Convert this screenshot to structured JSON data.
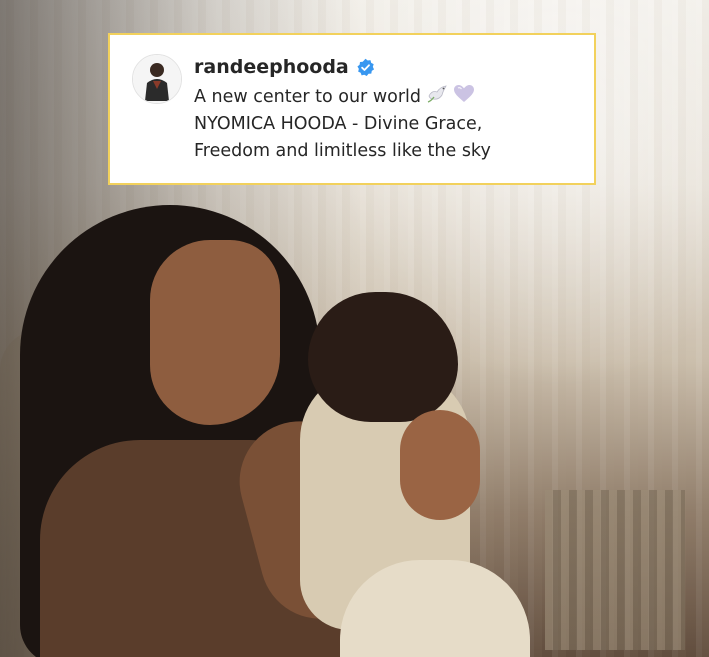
{
  "post": {
    "username": "randeephooda",
    "verified": true,
    "caption_lines": [
      "A new center to our world",
      "NYOMICA HOODA - Divine Grace,",
      "Freedom and limitless like the sky"
    ],
    "emojis": [
      "dove-icon",
      "heart-icon"
    ]
  },
  "colors": {
    "card_border": "#f2d15c",
    "verified_blue": "#3897f0",
    "text": "#262626",
    "heart": "#cbc3e3"
  }
}
